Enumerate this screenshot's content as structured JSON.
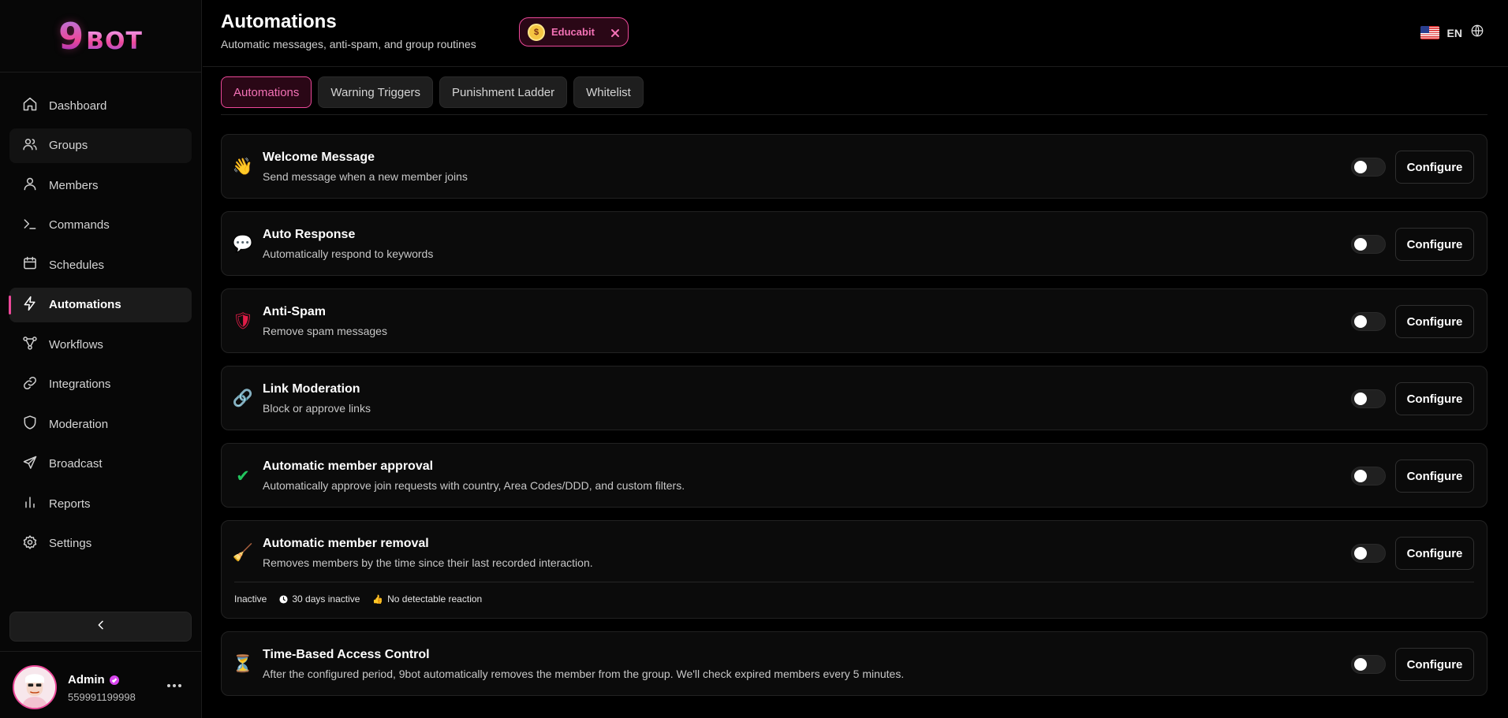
{
  "brand": {
    "logo_digit": "9",
    "logo_text": "BOT"
  },
  "sidebar": {
    "items": [
      {
        "label": "Dashboard",
        "icon": "home-icon"
      },
      {
        "label": "Groups",
        "icon": "users-icon"
      },
      {
        "label": "Members",
        "icon": "user-icon"
      },
      {
        "label": "Commands",
        "icon": "terminal-icon"
      },
      {
        "label": "Schedules",
        "icon": "calendar-icon"
      },
      {
        "label": "Automations",
        "icon": "zap-icon",
        "active": true
      },
      {
        "label": "Workflows",
        "icon": "workflow-icon"
      },
      {
        "label": "Integrations",
        "icon": "link-icon"
      },
      {
        "label": "Moderation",
        "icon": "shield-icon"
      },
      {
        "label": "Broadcast",
        "icon": "send-icon"
      },
      {
        "label": "Reports",
        "icon": "bar-chart-icon"
      },
      {
        "label": "Settings",
        "icon": "gear-icon"
      }
    ]
  },
  "user": {
    "name": "Admin",
    "phone": "559991199998"
  },
  "header": {
    "title": "Automations",
    "subtitle": "Automatic messages, anti-spam, and group routines",
    "group_chip": "Educabit",
    "language": "EN"
  },
  "tabs": [
    "Automations",
    "Warning Triggers",
    "Punishment Ladder",
    "Whitelist"
  ],
  "configure_label": "Configure",
  "cards": [
    {
      "icon": "👋",
      "title": "Welcome Message",
      "description": "Send message when a new member joins"
    },
    {
      "icon": "💬",
      "title": "Auto Response",
      "description": "Automatically respond to keywords"
    },
    {
      "icon": "🛡",
      "title": "Anti-Spam",
      "description": "Remove spam messages"
    },
    {
      "icon": "🔗",
      "title": "Link Moderation",
      "description": "Block or approve links"
    },
    {
      "icon": "✔",
      "title": "Automatic member approval",
      "description": "Automatically approve join requests with country, Area Codes/DDD, and custom filters."
    },
    {
      "icon": "🧹",
      "title": "Automatic member removal",
      "description": "Removes members by the time since their last recorded interaction."
    },
    {
      "icon": "⏳",
      "title": "Time-Based Access Control",
      "description": "After the configured period, 9bot automatically removes the member from the group. We'll check expired members every 5 minutes."
    }
  ],
  "removal_meta": {
    "status": "Inactive",
    "days": "30 days inactive",
    "reaction": "No detectable reaction"
  },
  "colors": {
    "accent": "#ec4899",
    "background": "#000000",
    "card": "#0b0b0b"
  }
}
